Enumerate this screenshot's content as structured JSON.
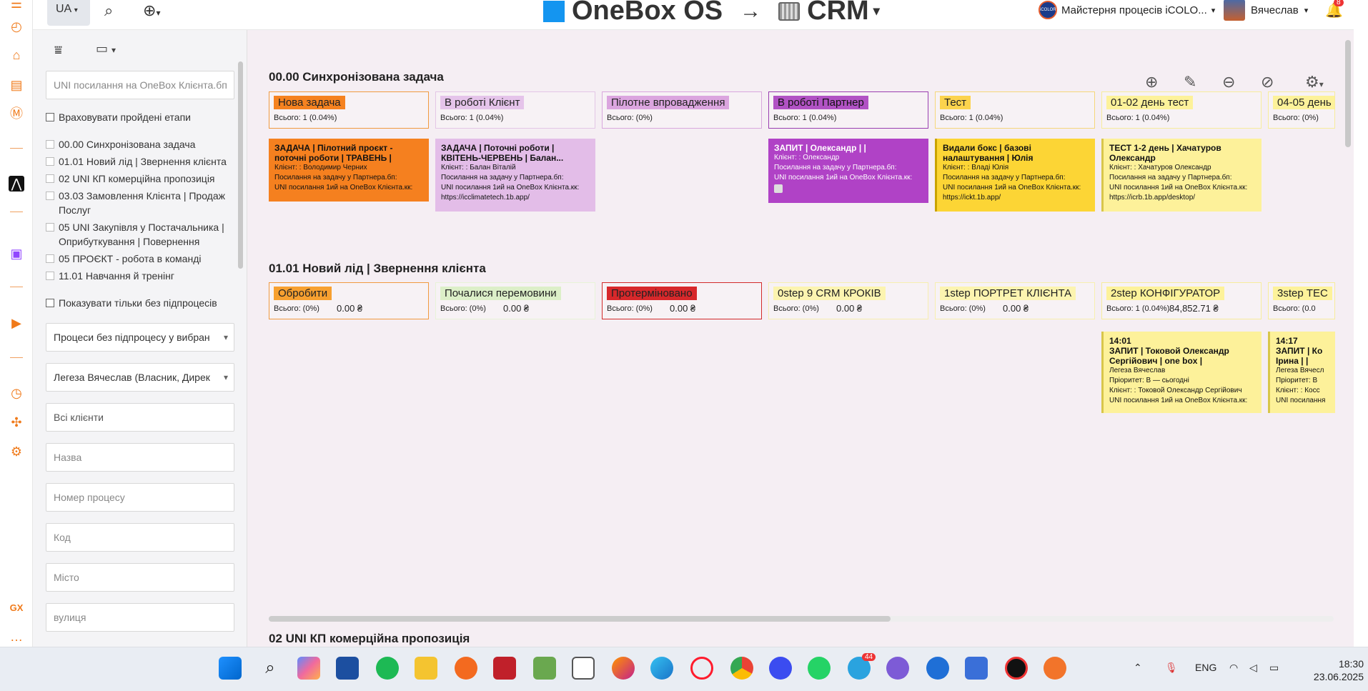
{
  "topbar": {
    "lang": "UA",
    "brand": "OneBox OS",
    "arrow": "→",
    "module": "CRM",
    "workspace": "Майстерня процесів iCOLO...",
    "workspace_logo": "iCOLOR",
    "user": "Вячеслав",
    "notif_count": "8"
  },
  "filters": {
    "uni_link_placeholder": "UNI посилання на OneBox Клієнта.бп",
    "account_passed": "Враховувати пройдені етапи",
    "processes": [
      "00.00 Синхронізована задача",
      "01.01 Новий лід | Звернення клієнта",
      "02 UNI КП комерційна пропозиція",
      "03.03 Замовлення Клієнта | Продаж Послуг",
      "05 UNI Закупівля у Постачальника | Оприбуткування | Повернення",
      "05 ПРОЄКТ - робота в команді",
      "11.01 Навчання й тренінг"
    ],
    "only_no_sub": "Показувати тільки без підпроцесів",
    "no_sub_select": "Процеси без підпроцесу у вибран",
    "owner_select": "Легеза Вячеслав (Власник, Дирек",
    "clients": "Всі клієнти",
    "name": "Назва",
    "process_number": "Номер процесу",
    "code": "Код",
    "city": "Місто",
    "street": "вулиця"
  },
  "board": {
    "s1": {
      "title": "00.00 Синхронізована задача",
      "columns": [
        {
          "label": "Нова задача",
          "count": "Всього: 1 (0.04%)"
        },
        {
          "label": "В роботі Клієнт",
          "count": "Всього: 1 (0.04%)"
        },
        {
          "label": "Пілотне впровадження",
          "count": "Всього: (0%)"
        },
        {
          "label": "В роботі Партнер",
          "count": "Всього: 1 (0.04%)"
        },
        {
          "label": "Тест",
          "count": "Всього: 1 (0.04%)"
        },
        {
          "label": "01-02 день тест",
          "count": "Всього: 1 (0.04%)"
        },
        {
          "label": "04-05 день",
          "count": "Всього: (0%)"
        }
      ],
      "cards": [
        {
          "title": "ЗАДАЧА | Пілотний проєкт - поточні роботи | ТРАВЕНЬ |",
          "l1": "Клієнт: : Володимир Черних",
          "l2": "Посилання на задачу у Партнера.бп:",
          "l3": "UNI посилання 1ий на OneBox Клієнта.кк:",
          "l4": ""
        },
        {
          "title": "ЗАДАЧА | Поточні роботи | КВІТЕНЬ-ЧЕРВЕНЬ | Балан...",
          "l1": "Клієнт: : Балан Віталій",
          "l2": "Посилання на задачу у Партнера.бп:",
          "l3": "UNI посилання 1ий на OneBox Клієнта.кк:",
          "l4": "https://icclimatetech.1b.app/"
        },
        {
          "title": "ЗАПИТ | Олександр | |",
          "l1": "Клієнт: : Олександр",
          "l2": "Посилання на задачу у Партнера.бп:",
          "l3": "UNI посилання 1ий на OneBox Клієнта.кк:",
          "l4": ""
        },
        {
          "title": "Видали бокс | базові налаштування | Юлія",
          "l1": "Клієнт: : Владі Юлія",
          "l2": "Посилання на задачу у Партнера.бп:",
          "l3": "UNI посилання 1ий на OneBox Клієнта.кк:",
          "l4": "https://ickt.1b.app/"
        },
        {
          "title": "ТЕСТ 1-2 день | Хачатуров Олександр",
          "l1": "Клієнт: : Хачатуров Олександр",
          "l2": "Посилання на задачу у Партнера.бп:",
          "l3": "UNI посилання 1ий на OneBox Клієнта.кк:",
          "l4": "https://icrb.1b.app/desktop/"
        }
      ]
    },
    "s2": {
      "title": "01.01 Новий лід | Звернення клієнта",
      "columns": [
        {
          "label": "Обробити",
          "count": "Всього: (0%)",
          "sum": "0.00 ₴"
        },
        {
          "label": "Почалися перемовини",
          "count": "Всього: (0%)",
          "sum": "0.00 ₴"
        },
        {
          "label": "Протерміновано",
          "count": "Всього: (0%)",
          "sum": "0.00 ₴"
        },
        {
          "label": "0step 9 CRM КРОКІВ",
          "count": "Всього: (0%)",
          "sum": "0.00 ₴"
        },
        {
          "label": "1step ПОРТРЕТ КЛІЄНТА",
          "count": "Всього: (0%)",
          "sum": "0.00 ₴"
        },
        {
          "label": "2step КОНФІГУРАТОР",
          "count": "Всього: 1 (0.04%)",
          "sum": "84,852.71 ₴"
        },
        {
          "label": "3step ТЕС",
          "count": "Всього: (0.0",
          "sum": ""
        }
      ],
      "cards": [
        {
          "time": "14:01",
          "title": "ЗАПИТ | Токовой Олександр Сергійович | one box |",
          "l1": "Легеза Вячеслав",
          "l2": "Пріоритет: В — сьогодні",
          "l3": "Клієнт: : Токовой Олександр Сергійович",
          "l4": "UNI посилання 1ий на OneBox Клієнта.кк:"
        },
        {
          "time": "14:17",
          "title": "ЗАПИТ | Ко Ірина | |",
          "l1": "Легеза Вячесл",
          "l2": "Пріоритет: В",
          "l3": "Клієнт: : Косс",
          "l4": "UNI посилання"
        }
      ]
    },
    "s3": {
      "title": "02 UNI КП комерційна пропозиція"
    }
  },
  "taskbar": {
    "lang": "ENG",
    "time": "18:30",
    "date": "23.06.2025",
    "telegram_badge": "44"
  }
}
